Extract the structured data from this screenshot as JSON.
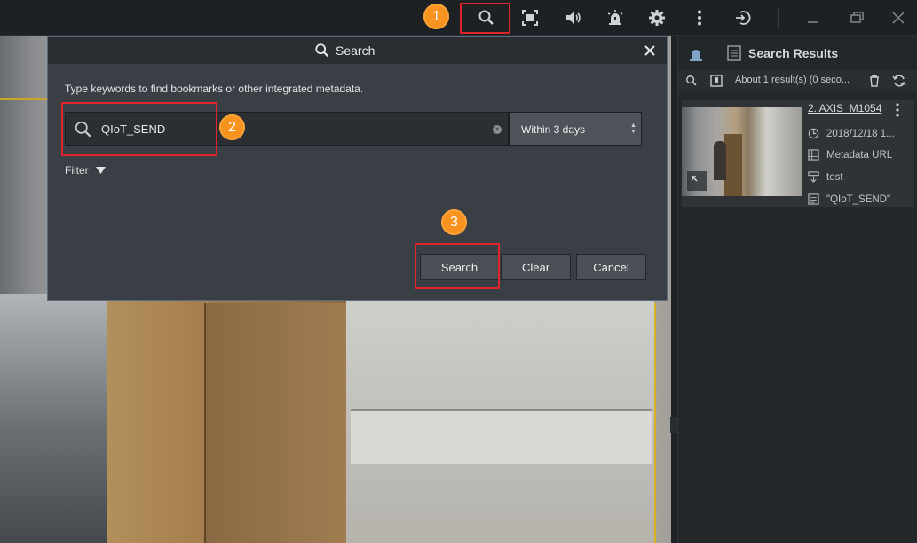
{
  "toolbar": {
    "icons": [
      "search-icon",
      "fullscreen-icon",
      "volume-icon",
      "alarm-icon",
      "gear-icon",
      "more-vertical-icon",
      "logout-icon",
      "minimize-icon",
      "restore-icon",
      "close-icon"
    ]
  },
  "annotations": {
    "step1": "1",
    "step2": "2",
    "step3": "3"
  },
  "dialog": {
    "title": "Search",
    "description": "Type keywords to find bookmarks or other integrated metadata.",
    "search_value": "QIoT_SEND",
    "time_range": "Within 3 days",
    "filter_label": "Filter",
    "search_button": "Search",
    "clear_button": "Clear",
    "cancel_button": "Cancel"
  },
  "results_panel": {
    "title": "Search Results",
    "summary": "About 1 result(s) (0 seco...",
    "result": {
      "camera": "2. AXIS_M1054",
      "timestamp": "2018/12/18 1...",
      "metadata_source": "Metadata URL",
      "tag": "test",
      "keyword": "\"QIoT_SEND\""
    }
  },
  "colors": {
    "accent_badge": "#f7931e",
    "highlight_box": "#e0242b",
    "dialog_bg": "#3a3f45"
  }
}
